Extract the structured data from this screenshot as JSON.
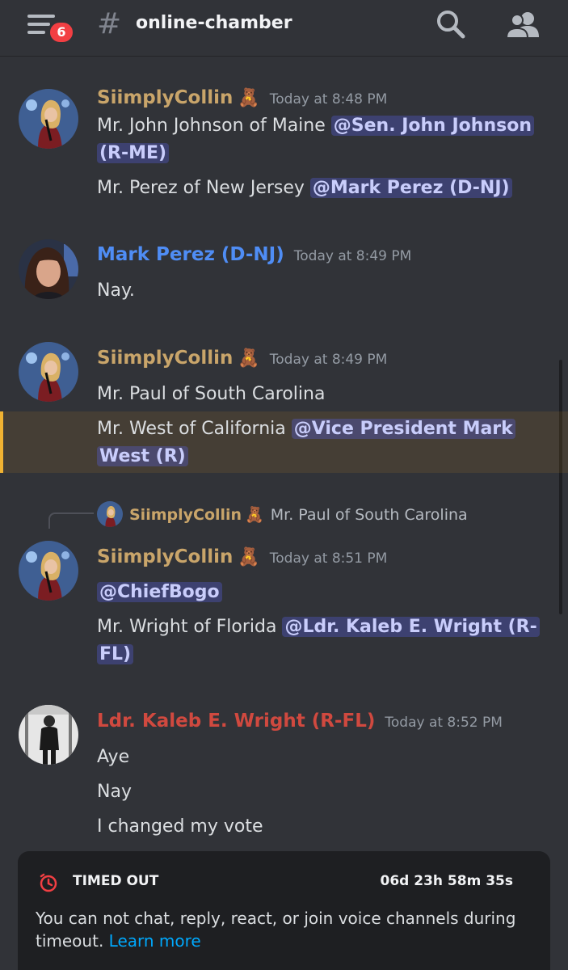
{
  "header": {
    "unread_count": "6",
    "hash": "#",
    "channel_name": "online-chamber"
  },
  "colors": {
    "background": "#313338",
    "collin": "#c9a56a",
    "perez": "#4f8df5",
    "wright": "#d0493f",
    "mention_bg": "#5865f24d",
    "highlight_bar": "#f0b232",
    "link": "#00a8fc",
    "timeout_red": "#f23f43"
  },
  "messages": [
    {
      "author": "SiimplyCollin",
      "emoji": "🧸",
      "time": "Today at 8:48 PM",
      "lines": [
        {
          "text1": "Mr. John Johnson of Maine ",
          "mention1": "@Sen. John Johnson",
          "mention2": "(R-ME)"
        },
        {
          "text": "Mr. Perez of New Jersey ",
          "mention": "@Mark Perez (D-NJ)"
        }
      ]
    },
    {
      "author": "Mark Perez (D-NJ)",
      "time": "Today at 8:49 PM",
      "lines": [
        {
          "text": "Nay."
        }
      ]
    },
    {
      "author": "SiimplyCollin",
      "emoji": "🧸",
      "time": "Today at 8:49 PM",
      "lines": [
        {
          "text": "Mr. Paul of South Carolina"
        },
        {
          "text": "Mr. West of California ",
          "mention1": "@Vice President Mark",
          "mention2": "West (R)"
        }
      ]
    },
    {
      "reply": {
        "author": "SiimplyCollin",
        "emoji": "🧸",
        "text": "Mr. Paul of South Carolina"
      },
      "author": "SiimplyCollin",
      "emoji": "🧸",
      "time": "Today at 8:51 PM",
      "lines": [
        {
          "mention": "@ChiefBogo"
        },
        {
          "text": "Mr. Wright of Florida ",
          "mention1": "@Ldr. Kaleb E. Wright (R-",
          "mention2": "FL)"
        }
      ]
    },
    {
      "author": "Ldr. Kaleb E. Wright (R-FL)",
      "time": "Today at 8:52 PM",
      "lines": [
        {
          "text": "Aye"
        },
        {
          "text": "Nay"
        },
        {
          "text": "I changed my vote"
        }
      ]
    }
  ],
  "timeout": {
    "title": "TIMED OUT",
    "remaining": "06d 23h 58m 35s",
    "message": "You can not chat, reply, react, or join voice channels during timeout.",
    "link": "Learn more"
  }
}
